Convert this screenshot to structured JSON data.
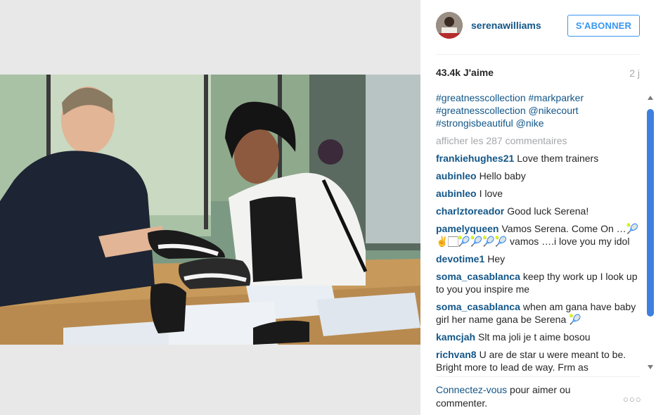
{
  "header": {
    "username": "serenawilliams",
    "follow_label": "S'ABONNER"
  },
  "stats": {
    "likes": "43.4k J'aime",
    "age": "2 j"
  },
  "caption": {
    "line1": "#greatnesscollection #markparker",
    "line2": "#greatnesscollection @nikecourt",
    "line3": "#strongisbeautiful @nike"
  },
  "more_comments": "afficher les 287 commentaires",
  "comments": [
    {
      "user": "frankiehughes21",
      "text": "Love them trainers"
    },
    {
      "user": "aubinleo",
      "text": "Hello baby"
    },
    {
      "user": "aubinleo",
      "text": "I love"
    },
    {
      "user": "charlztoreador",
      "text": "Good luck Serena!"
    },
    {
      "user": "pamelyqueen",
      "text": "Vamos Serena. Come On …🎾✌️🏻🎾🎾🎾🎾 vamos ….i love you my idol"
    },
    {
      "user": "devotime1",
      "text": "Hey"
    },
    {
      "user": "soma_casablanca",
      "text": "keep thy work up I look up to you you inspire me"
    },
    {
      "user": "soma_casablanca",
      "text": "when am gana have baby girl her name gana be Serena 🎾"
    },
    {
      "user": "kamcjah",
      "text": "Slt ma joli je t aime bosou"
    },
    {
      "user": "richvan8",
      "text": "U are de star u were meant to be. Bright more to lead de way. Frm as"
    }
  ],
  "footer": {
    "login_link": "Connectez-vous",
    "rest": " pour aimer ou commenter."
  },
  "icons": {
    "more_options": "more-options-icon",
    "scroll_up": "scroll-up-icon",
    "scroll_down": "scroll-down-icon"
  },
  "colors": {
    "link_blue": "#125688",
    "follow_blue": "#3897f0",
    "muted_gray": "#a5a7aa",
    "scroll_thumb": "#3f7fe0"
  }
}
